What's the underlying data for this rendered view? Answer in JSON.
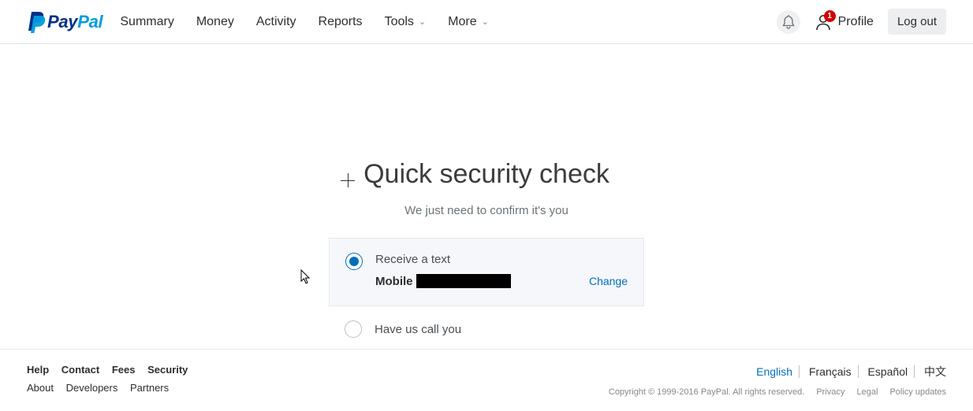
{
  "logo": {
    "part1": "Pay",
    "part2": "Pal"
  },
  "nav": {
    "summary": "Summary",
    "money": "Money",
    "activity": "Activity",
    "reports": "Reports",
    "tools": "Tools",
    "more": "More"
  },
  "header": {
    "profile_label": "Profile",
    "badge_count": "1",
    "logout": "Log out"
  },
  "main": {
    "title": "Quick security check",
    "subtitle": "We just need to confirm it's you",
    "option1_label": "Receive a text",
    "mobile_label": "Mobile",
    "change": "Change",
    "option2_label": "Have us call you"
  },
  "footer": {
    "left_row1": {
      "help": "Help",
      "contact": "Contact",
      "fees": "Fees",
      "security": "Security"
    },
    "left_row2": {
      "about": "About",
      "developers": "Developers",
      "partners": "Partners"
    },
    "langs": {
      "english": "English",
      "francais": "Français",
      "espanol": "Español",
      "zhongwen": "中文"
    },
    "copyright": "Copyright © 1999-2016 PayPal. All rights reserved.",
    "links": {
      "privacy": "Privacy",
      "legal": "Legal",
      "policy": "Policy updates"
    }
  }
}
